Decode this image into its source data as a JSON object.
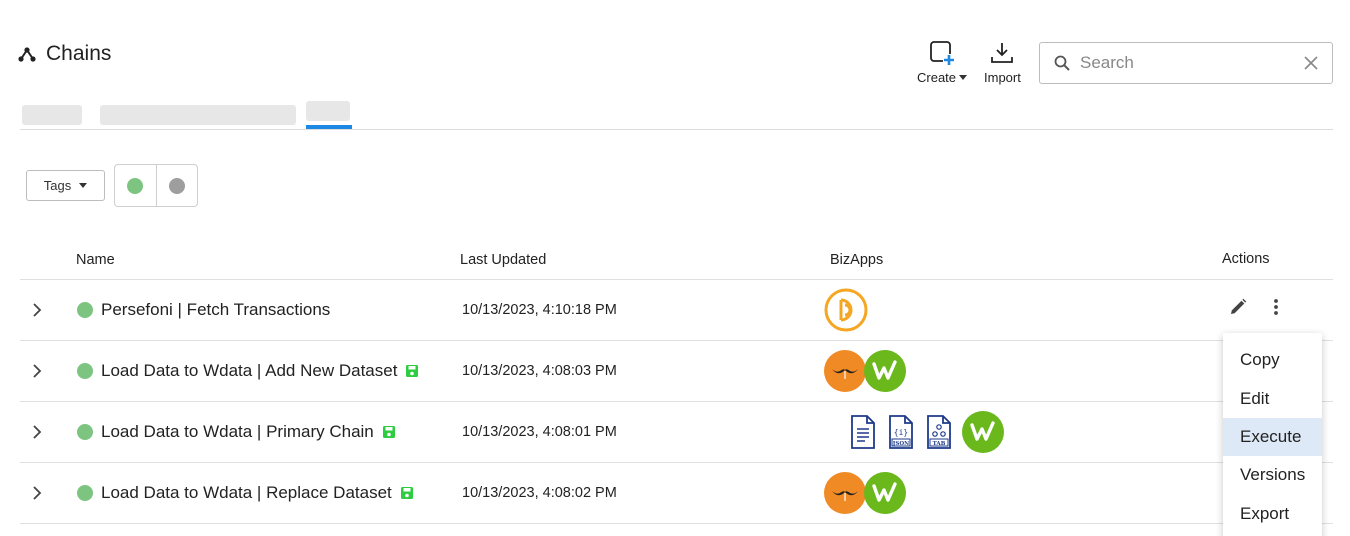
{
  "header": {
    "title": "Chains",
    "icon": "chain-hub-icon"
  },
  "toolbar": {
    "create_label": "Create",
    "import_label": "Import",
    "search_placeholder": "Search"
  },
  "filters": {
    "tags_label": "Tags"
  },
  "colors": {
    "accent": "#1e88e5",
    "active_dot": "#7cc47f",
    "inactive_dot": "#9e9e9e",
    "menu_highlight": "#dde9f7"
  },
  "table": {
    "headers": {
      "name": "Name",
      "last_updated": "Last Updated",
      "bizapps": "BizApps",
      "actions": "Actions"
    },
    "rows": [
      {
        "name": "Persefoni | Fetch Transactions",
        "updated": "10/13/2023, 4:10:18 PM",
        "saved": false,
        "apps": [
          "persefoni-logo"
        ]
      },
      {
        "name": "Load Data to Wdata | Add New Dataset",
        "updated": "10/13/2023, 4:08:03 PM",
        "saved": true,
        "apps": [
          "mustache-logo",
          "wdata-logo"
        ]
      },
      {
        "name": "Load Data to Wdata | Primary Chain",
        "updated": "10/13/2023, 4:08:01 PM",
        "saved": true,
        "apps": [
          "text-file-icon",
          "json-file-icon",
          "tab-file-icon",
          "wdata-logo"
        ]
      },
      {
        "name": "Load Data to Wdata | Replace Dataset",
        "updated": "10/13/2023, 4:08:02 PM",
        "saved": true,
        "apps": [
          "mustache-logo",
          "wdata-logo"
        ]
      }
    ]
  },
  "menu": {
    "items": [
      "Copy",
      "Edit",
      "Execute",
      "Versions",
      "Export"
    ],
    "highlighted": "Execute"
  },
  "doc_icons": {
    "json": "JSON",
    "tab": "TAB"
  }
}
